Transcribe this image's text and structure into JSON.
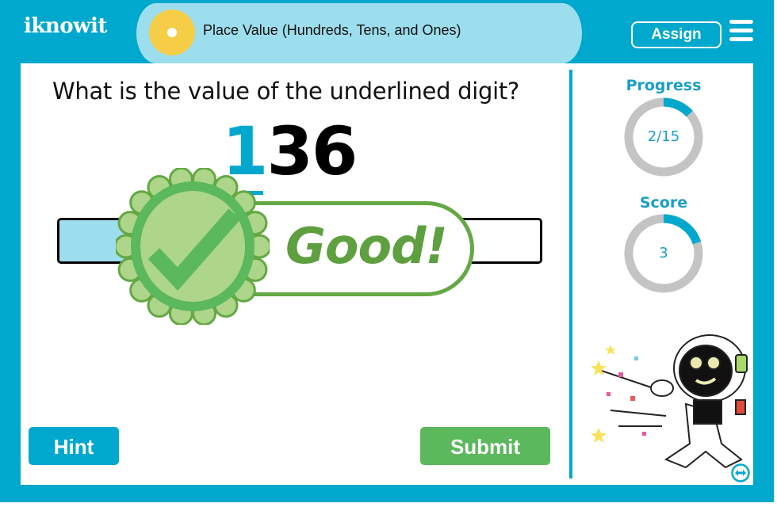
{
  "header": {
    "logo_text": "iknowit",
    "title": "Place Value (Hundreds, Tens, and Ones)",
    "assign_label": "Assign",
    "menu_icon": "hamburger-menu-icon",
    "topic_icon": "sun-dot-icon"
  },
  "question": {
    "prompt": "What is the value of the underlined digit?",
    "number_digits": [
      "1",
      "3",
      "6"
    ],
    "underlined_index": 0
  },
  "feedback": {
    "message": "Good!",
    "icon": "checkmark-badge-icon"
  },
  "buttons": {
    "hint_label": "Hint",
    "submit_label": "Submit"
  },
  "sidebar": {
    "progress": {
      "label": "Progress",
      "text": "2/15",
      "current": 2,
      "total": 15
    },
    "score": {
      "label": "Score",
      "text": "3",
      "value": 3,
      "fraction": 0.2
    },
    "mascot_icon": "astronaut-robot-icon",
    "swap_icon": "swap-horizontal-icon"
  },
  "colors": {
    "brand": "#00a8cd",
    "title_bg": "#9cdeee",
    "sun": "#f5cd47",
    "success": "#5cb85c",
    "feedback_green": "#64a844",
    "ring_track": "#c4c4c4"
  }
}
